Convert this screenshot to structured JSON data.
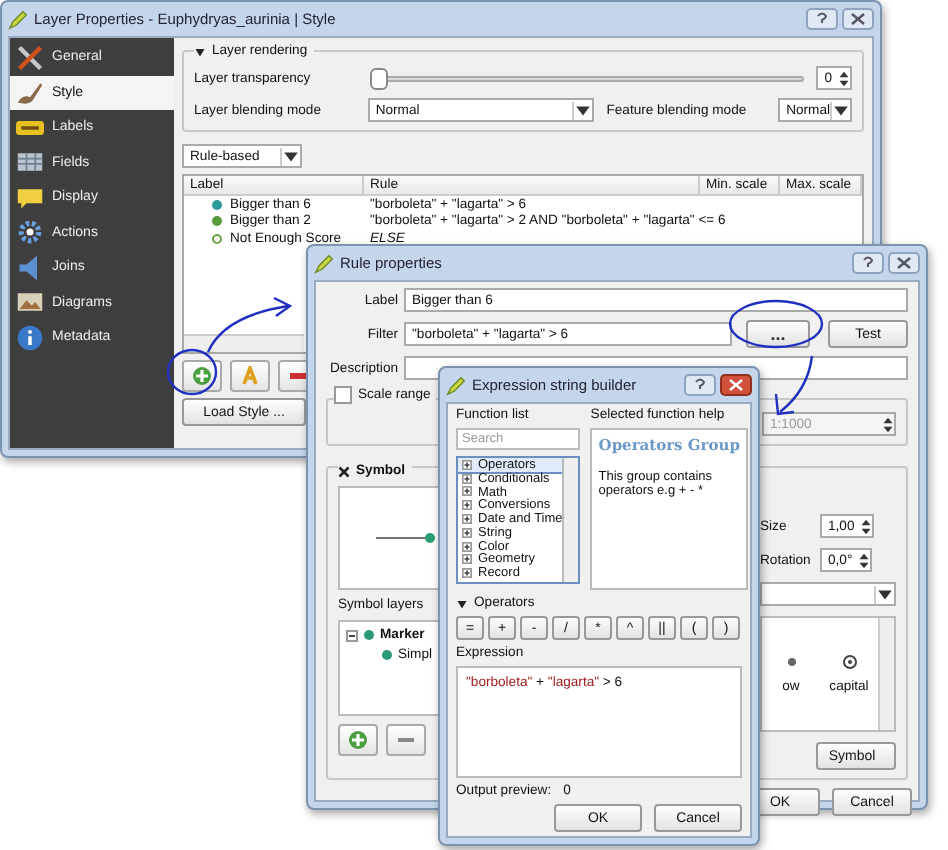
{
  "layer_properties": {
    "title": "Layer Properties - Euphydryas_aurinia | Style",
    "sidebar": [
      {
        "label": "General",
        "selected": false
      },
      {
        "label": "Style",
        "selected": true
      },
      {
        "label": "Labels",
        "selected": false
      },
      {
        "label": "Fields",
        "selected": false
      },
      {
        "label": "Display",
        "selected": false
      },
      {
        "label": "Actions",
        "selected": false
      },
      {
        "label": "Joins",
        "selected": false
      },
      {
        "label": "Diagrams",
        "selected": false
      },
      {
        "label": "Metadata",
        "selected": false
      }
    ],
    "rendering": {
      "title": "Layer rendering",
      "expanded": true,
      "transparency_label": "Layer transparency",
      "transparency_slider": {
        "level": 0
      },
      "transparency_value": "0",
      "blending_label": "Layer blending mode",
      "blending_value": "Normal",
      "feature_blending_label": "Feature blending mode",
      "feature_blending_value": "Normal"
    },
    "renderer": "Rule-based",
    "rules_table": {
      "columns": [
        "Label",
        "Rule",
        "Min. scale",
        "Max. scale"
      ],
      "rows": [
        {
          "label": "Bigger than 6",
          "rule": "\"borboleta\" + \"lagarta\" > 6",
          "kind": "filter",
          "color": "#2f9a9a"
        },
        {
          "label": "Bigger than 2",
          "rule": "\"borboleta\" + \"lagarta\" > 2 AND \"borboleta\" + \"lagarta\" <= 6",
          "kind": "filter",
          "color": "#5a9a3c"
        },
        {
          "label": "Not Enough Score",
          "rule": "ELSE",
          "kind": "else",
          "color": "#6aa040"
        }
      ]
    },
    "load_style": "Load Style ..."
  },
  "rule_properties": {
    "title": "Rule properties",
    "label_caption": "Label",
    "label_value": "Bigger than 6",
    "filter_caption": "Filter",
    "filter_value": "\"borboleta\" + \"lagarta\" > 6",
    "expression_button": "...",
    "test_button": "Test",
    "description_caption": "Description",
    "scale_range": {
      "label": "Scale range",
      "checked": false,
      "max_scale": "1:1000"
    },
    "symbol": {
      "title": "Symbol",
      "size_caption": "Size",
      "size_value": "1,00",
      "rotation_caption": "Rotation",
      "rotation_value": "0,0°",
      "symbol_layers_caption": "Symbol layers",
      "layers": [
        {
          "label": "Marker",
          "expanded": true,
          "children": [
            {
              "label": "Simpl"
            }
          ]
        }
      ],
      "library": [
        "ow",
        "capital"
      ],
      "symbol_button": "Symbol"
    },
    "buttons": [
      "OK",
      "Cancel"
    ]
  },
  "expression_builder": {
    "title": "Expression string builder",
    "function_list_caption": "Function list",
    "search_placeholder": "Search",
    "functions": [
      {
        "label": "Operators",
        "selected": true
      },
      {
        "label": "Conditionals",
        "selected": false
      },
      {
        "label": "Math",
        "selected": false
      },
      {
        "label": "Conversions",
        "selected": false
      },
      {
        "label": "Date and Time",
        "selected": false
      },
      {
        "label": "String",
        "selected": false
      },
      {
        "label": "Color",
        "selected": false
      },
      {
        "label": "Geometry",
        "selected": false
      },
      {
        "label": "Record",
        "selected": false
      }
    ],
    "help_caption": "Selected function help",
    "help_title": "Operators Group",
    "help_text": "This group contains operators e.g + - *",
    "operators_caption": "Operators",
    "operators_expanded": true,
    "operators": [
      "=",
      "+",
      "-",
      "/",
      "*",
      "^",
      "||",
      "(",
      ")"
    ],
    "expression_caption": "Expression",
    "expression": [
      {
        "text": "\"borboleta\"",
        "kind": "field"
      },
      {
        "text": " + ",
        "kind": "plain"
      },
      {
        "text": "\"lagarta\"",
        "kind": "field"
      },
      {
        "text": " > 6",
        "kind": "plain"
      }
    ],
    "output_caption": "Output preview:",
    "output_value": "0",
    "buttons": [
      "OK",
      "Cancel"
    ]
  }
}
